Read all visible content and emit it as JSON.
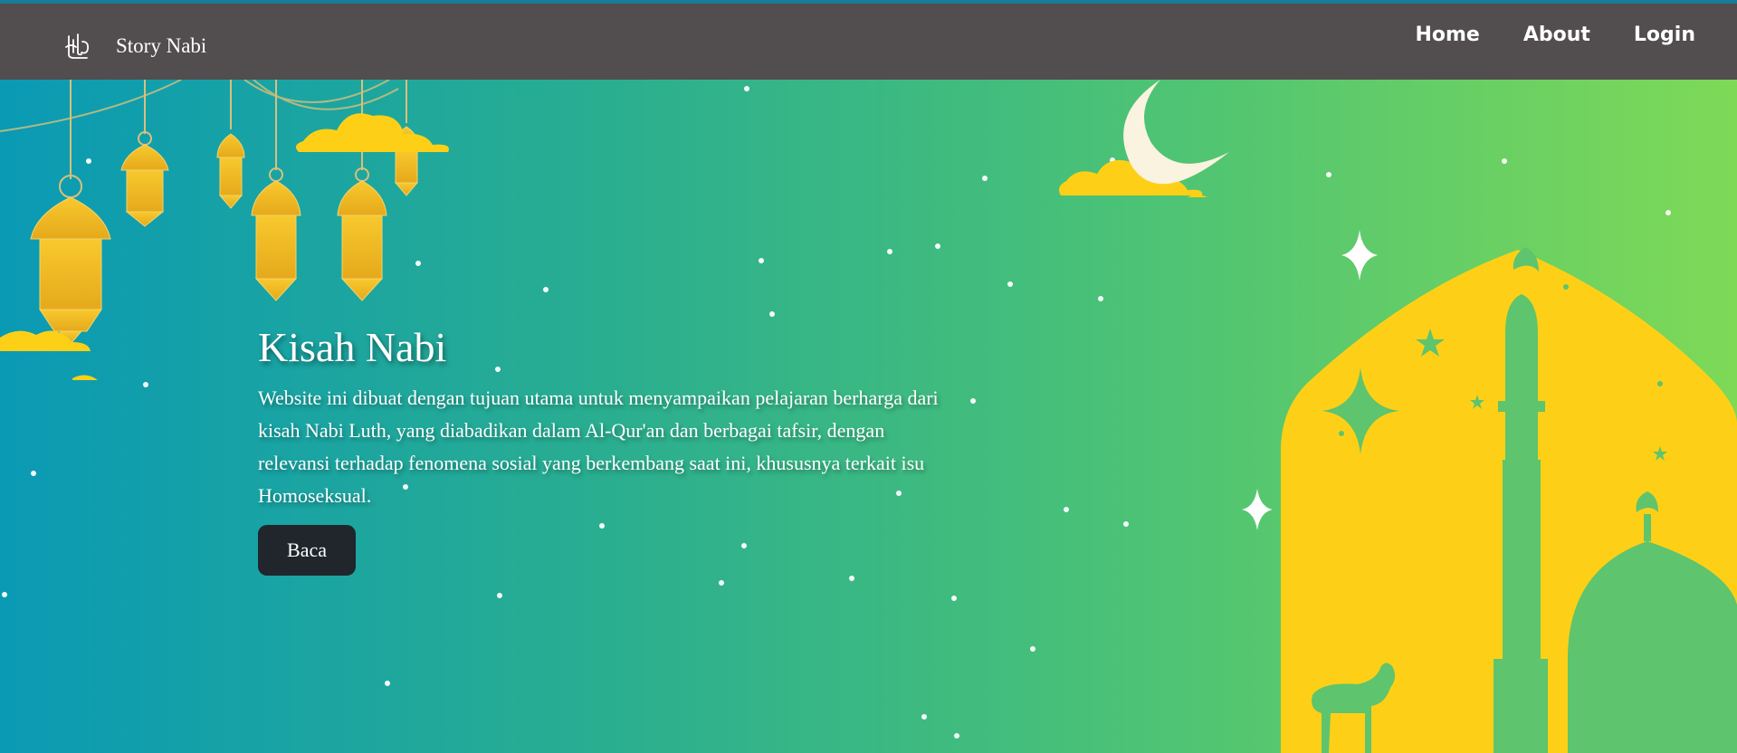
{
  "brand": {
    "name": "Story Nabi",
    "logo_icon": "calligraphy-logo-icon"
  },
  "nav": {
    "links": [
      {
        "label": "Home"
      },
      {
        "label": "About"
      },
      {
        "label": "Login"
      }
    ]
  },
  "hero": {
    "title": "Kisah Nabi",
    "description": "Website ini dibuat dengan tujuan utama untuk menyampaikan pelajaran berharga dari kisah Nabi Luth, yang diabadikan dalam Al-Qur'an dan berbagai tafsir, dengan relevansi terhadap fenomena sosial yang berkembang saat ini, khususnya terkait isu Homoseksual.",
    "button_label": "Baca"
  },
  "colors": {
    "navbar": "#524d4e",
    "gradient_start": "#0a9ab4",
    "gradient_end": "#7ed957",
    "accent_yellow": "#fdd017",
    "button": "#20262c"
  }
}
